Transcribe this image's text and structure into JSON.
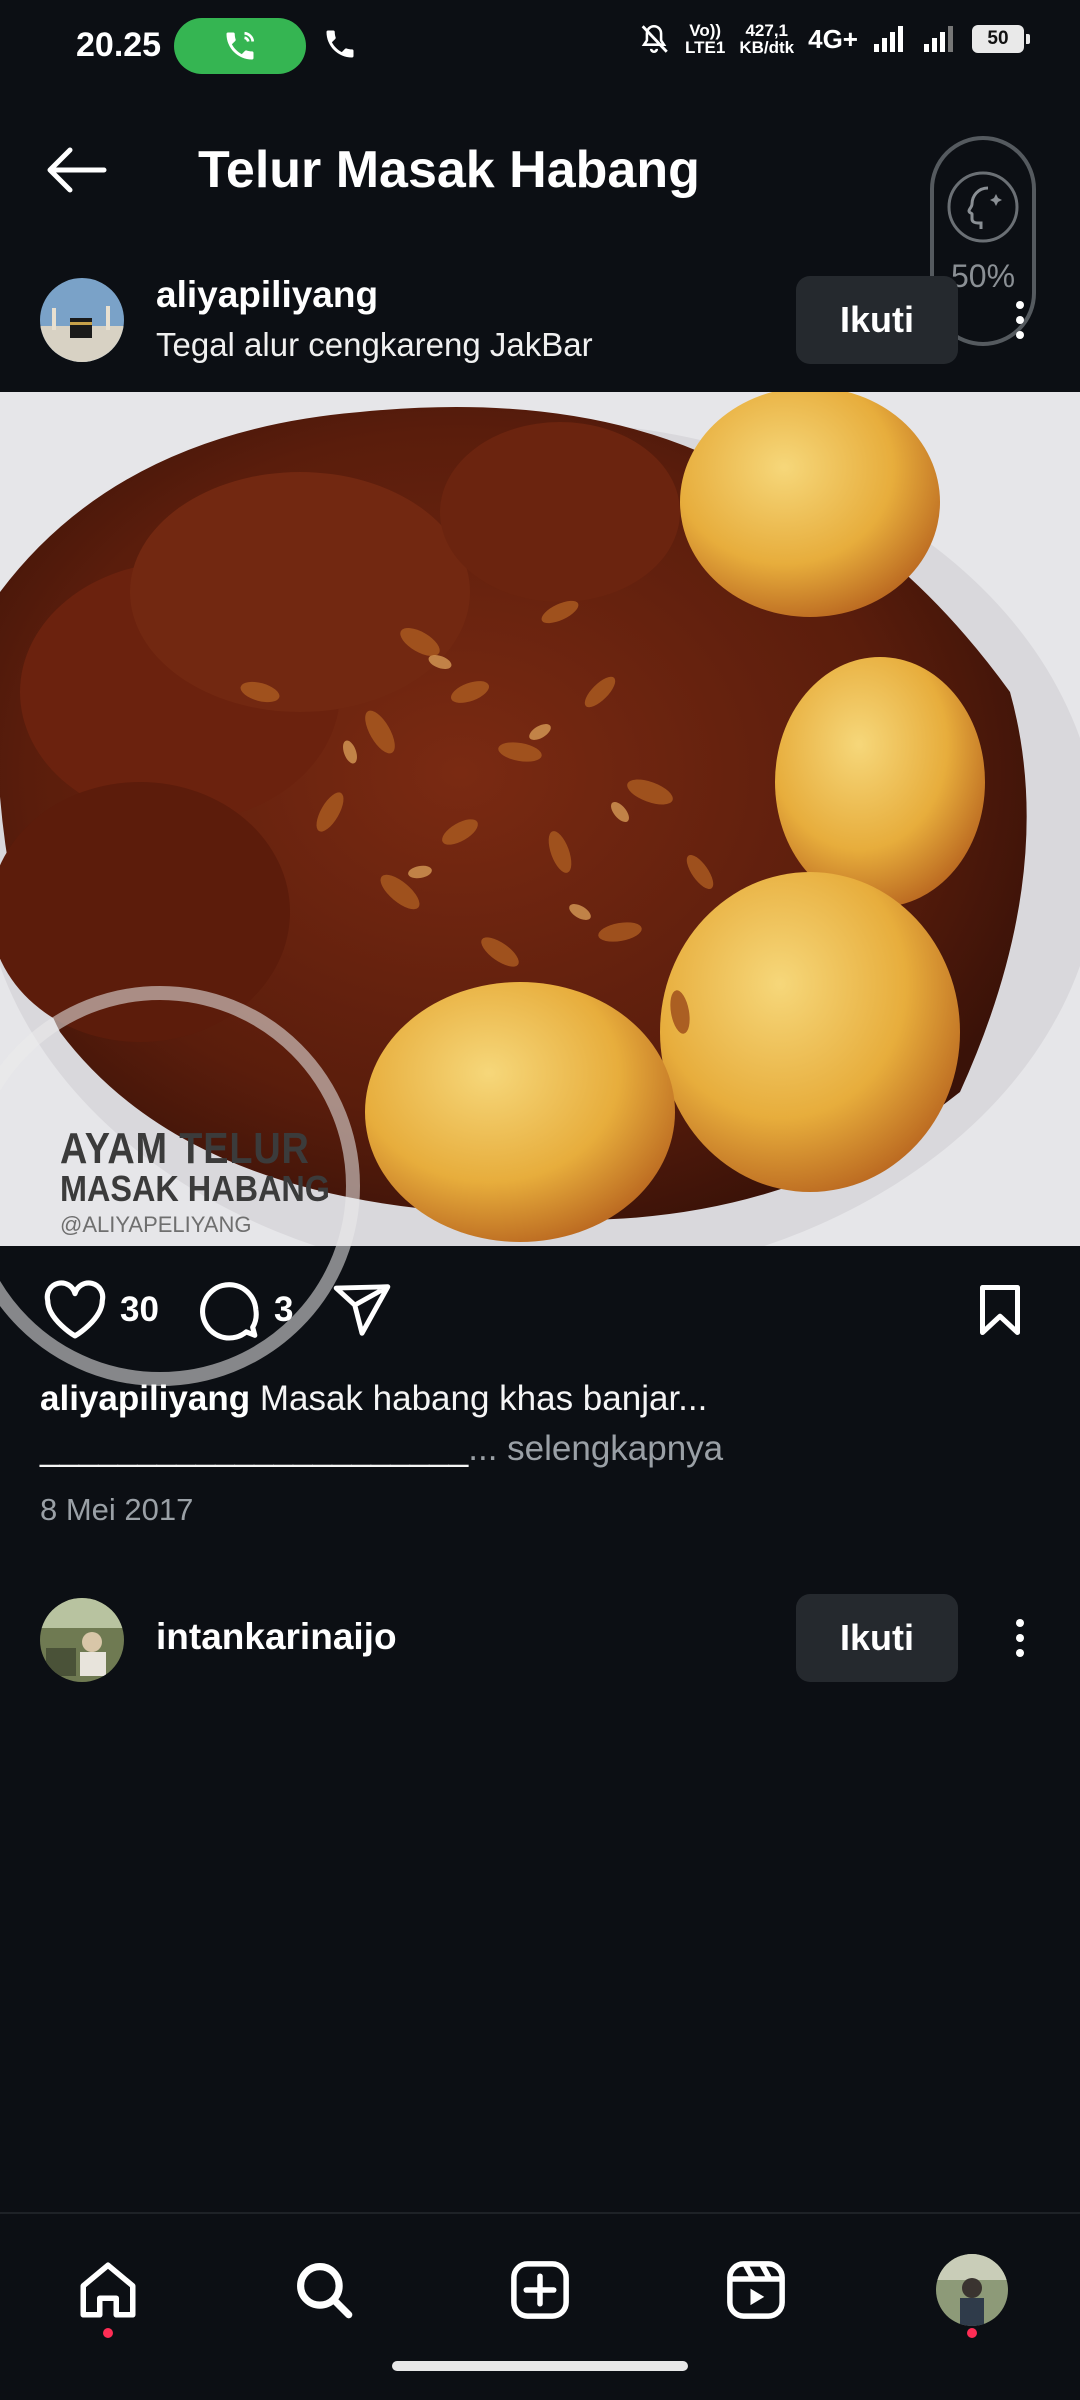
{
  "status_bar": {
    "time": "20.25",
    "volte_top": "Vo))",
    "volte_bottom": "LTE1",
    "speed_value": "427,1",
    "speed_unit": "KB/dtk",
    "network": "4G+",
    "battery": "50"
  },
  "header": {
    "title": "Telur Masak Habang",
    "floating_widget_percent": "50%"
  },
  "post": {
    "username": "aliyapiliyang",
    "location": "Tegal alur cengkareng JakBar",
    "follow_label": "Ikuti",
    "image_watermark": {
      "line1": "AYAM TELUR",
      "line2": "MASAK HABANG",
      "line3": "@ALIYAPELIYANG"
    },
    "likes": "30",
    "comments": "3",
    "caption_user": "aliyapiliyang",
    "caption_text": "Masak habang khas banjar...",
    "caption_line2_dashes": "______________________",
    "caption_more": "... selengkapnya",
    "date": "8 Mei 2017"
  },
  "next_post": {
    "username": "intankarinaijo",
    "follow_label": "Ikuti"
  },
  "bottom_nav": {
    "items": [
      "home-icon",
      "search-icon",
      "create-icon",
      "reels-icon",
      "profile-avatar"
    ],
    "notification_color": "#ff2d55"
  },
  "colors": {
    "background": "#0c0f14",
    "button": "#25292e",
    "call_pill": "#35b552"
  }
}
